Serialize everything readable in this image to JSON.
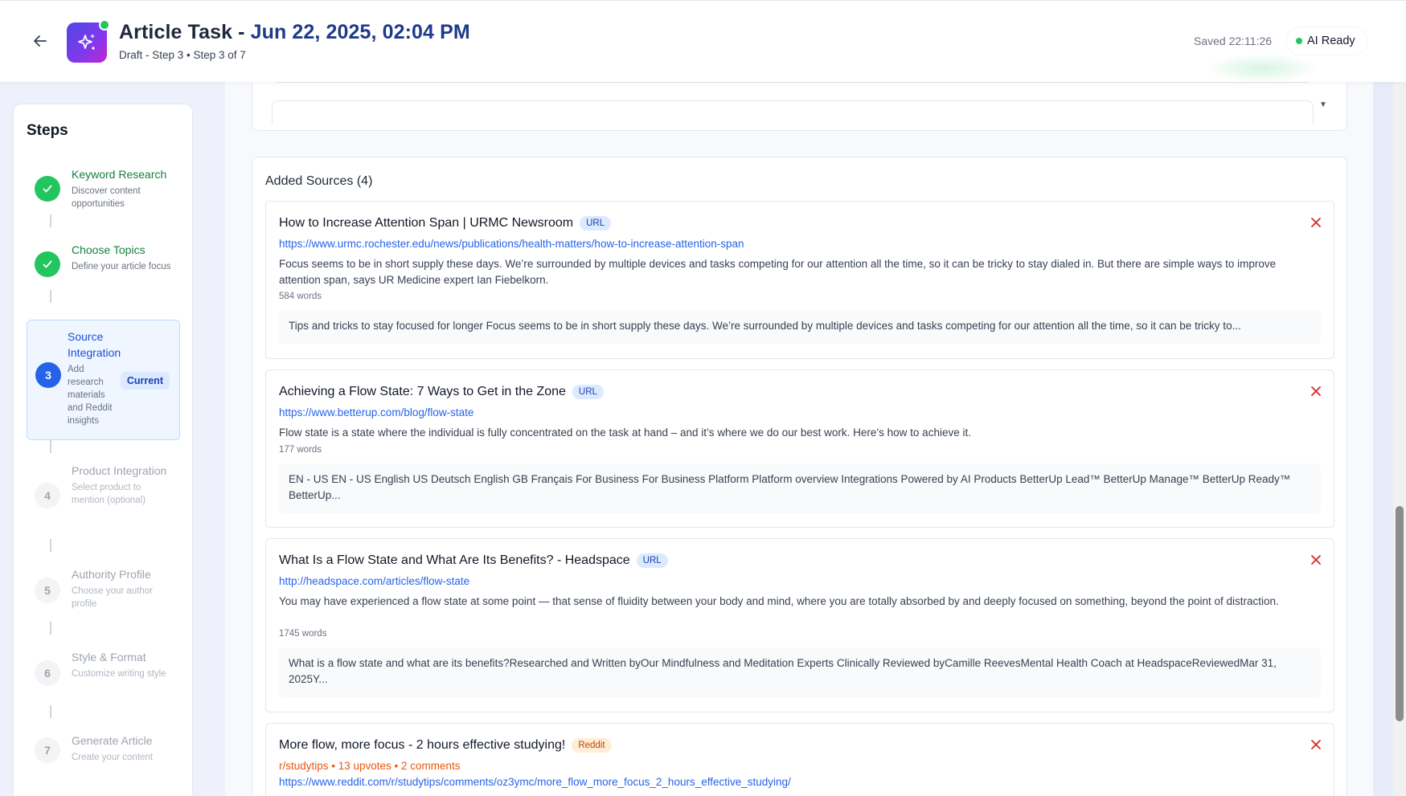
{
  "header": {
    "back_icon": "arrow-left-icon",
    "app_icon": "sparkles-icon",
    "title_prefix": "Article Task - ",
    "title_date": "Jun 22, 2025, 02:04 PM",
    "subtitle": "Draft - Step 3 • Step 3 of 7",
    "saved_status": "Saved 22:11:26",
    "ai_status": "AI Ready",
    "colors": {
      "accent": "#1e3a8a",
      "ready": "#22c55e",
      "icon_gradient_start": "#4f46e5",
      "icon_gradient_end": "#c026d3"
    }
  },
  "sidebar": {
    "heading": "Steps",
    "current_badge": "Current",
    "steps": [
      {
        "number": "1",
        "title": "Keyword Research",
        "description": "Discover content opportunities",
        "state": "done"
      },
      {
        "number": "2",
        "title": "Choose Topics",
        "description": "Define your article focus",
        "state": "done"
      },
      {
        "number": "3",
        "title": "Source Integration",
        "description": "Add research materials and Reddit insights",
        "state": "current"
      },
      {
        "number": "4",
        "title": "Product Integration",
        "description": "Select product to mention (optional)",
        "state": "pending"
      },
      {
        "number": "5",
        "title": "Authority Profile",
        "description": "Choose your author profile",
        "state": "pending"
      },
      {
        "number": "6",
        "title": "Style & Format",
        "description": "Customize writing style",
        "state": "pending"
      },
      {
        "number": "7",
        "title": "Generate Article",
        "description": "Create your content",
        "state": "pending"
      }
    ]
  },
  "sources": {
    "heading": "Added Sources (4)",
    "items": [
      {
        "title": "How to Increase Attention Span | URMC Newsroom",
        "type": "URL",
        "url": "https://www.urmc.rochester.edu/news/publications/health-matters/how-to-increase-attention-span",
        "description": "Focus seems to be in short supply these days. We’re surrounded by multiple devices and tasks competing for our attention all the time, so it can be tricky to stay dialed in. But there are simple ways to improve attention span, says UR Medicine expert Ian Fiebelkorn.",
        "words": "584 words",
        "excerpt": "Tips and tricks to stay focused for longer Focus seems to be in short supply these days. We’re surrounded by multiple devices and tasks competing for our attention all the time, so it can be tricky to..."
      },
      {
        "title": "Achieving a Flow State: 7 Ways to Get in the Zone",
        "type": "URL",
        "url": "https://www.betterup.com/blog/flow-state",
        "description": "Flow state is a state where the individual is fully concentrated on the task at hand – and it’s where we do our best work. Here’s how to achieve it.",
        "words": "177 words",
        "excerpt": "EN - US EN - US English US Deutsch English GB Français For Business For Business Platform Platform overview Integrations Powered by AI Products BetterUp Lead™ BetterUp Manage™ BetterUp Ready™ BetterUp..."
      },
      {
        "title": "What Is a Flow State and What Are Its Benefits? - Headspace",
        "type": "URL",
        "url": "http://headspace.com/articles/flow-state",
        "description": "You may have experienced a flow state at some point — that sense of fluidity between your body and mind, where you are totally absorbed by and deeply focused on something, beyond the point of distraction.",
        "words": "1745 words",
        "excerpt": "What is a flow state and what are its benefits?Researched and Written byOur Mindfulness and Meditation Experts Clinically Reviewed byCamille ReevesMental Health Coach at HeadspaceReviewedMar 31, 2025Y..."
      },
      {
        "title": "More flow, more focus - 2 hours effective studying!",
        "type": "Reddit",
        "meta": "r/studytips • 13 upvotes • 2 comments",
        "url": "https://www.reddit.com/r/studytips/comments/oz3ymc/more_flow_more_focus_2_hours_effective_studying/"
      }
    ]
  }
}
